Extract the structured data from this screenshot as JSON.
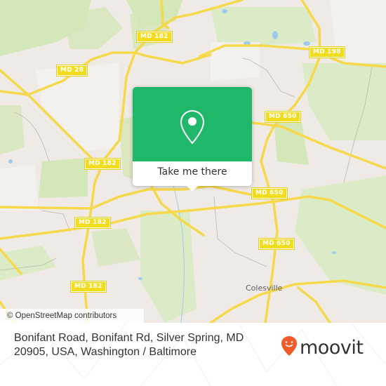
{
  "map": {
    "road_labels": [
      {
        "id": "md182-top",
        "text": "MD 182"
      },
      {
        "id": "md28",
        "text": "MD 28"
      },
      {
        "id": "md198",
        "text": "MD 198"
      },
      {
        "id": "md650-top",
        "text": "MD 650"
      },
      {
        "id": "md182-mid",
        "text": "MD 182"
      },
      {
        "id": "md182-left",
        "text": "MD 182"
      },
      {
        "id": "md650-mid",
        "text": "MD 650"
      },
      {
        "id": "md650-low",
        "text": "MD 650"
      },
      {
        "id": "md182-low",
        "text": "MD 182"
      }
    ],
    "place_labels": [
      {
        "text": "Colesville"
      }
    ],
    "attribution": "© OpenStreetMap contributors",
    "colors": {
      "road": "#f5d94a",
      "shield": "#f2dc1e",
      "park": "#cfe5b0",
      "land": "#efeae6",
      "water": "#9ecbea"
    }
  },
  "popup": {
    "icon": "map-pin-icon",
    "button_label": "Take me there",
    "color": "#1fb86a"
  },
  "footer": {
    "address": "Bonifant Road, Bonifant Rd, Silver Spring, MD 20905, USA, Washington / Baltimore",
    "brand": "moovit",
    "brand_color": "#f05a28"
  }
}
